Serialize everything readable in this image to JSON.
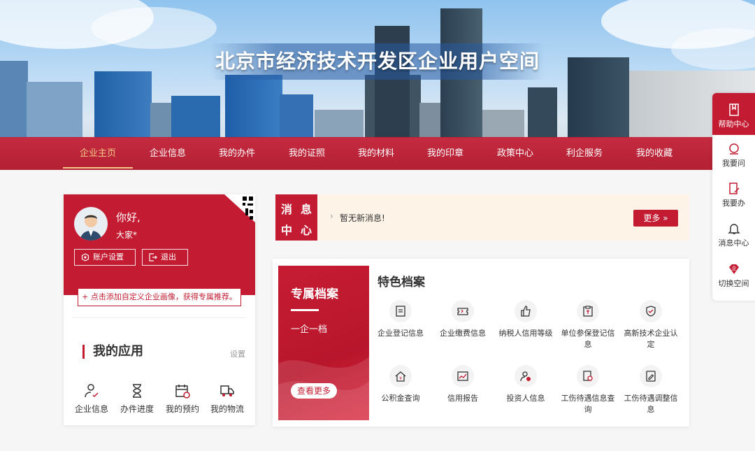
{
  "banner": {
    "title": "北京市经济技术开发区企业用户空间"
  },
  "nav": {
    "items": [
      "企业主页",
      "企业信息",
      "我的办件",
      "我的证照",
      "我的材料",
      "我的印章",
      "政策中心",
      "利企服务",
      "我的收藏"
    ],
    "active_index": 0
  },
  "sidebar": {
    "items": [
      "帮助中心",
      "我要问",
      "我要办",
      "消息中心",
      "切换空间"
    ]
  },
  "profile": {
    "greeting": "你好,",
    "username": "大家*",
    "account_btn": "账户设置",
    "logout_btn": "退出",
    "add_portrait": "+ 点击添加自定义企业画像，获得专属推荐。"
  },
  "my_apps": {
    "title": "我的应用",
    "setting": "设置",
    "items": [
      "企业信息",
      "办件进度",
      "我的预约",
      "我的物流"
    ]
  },
  "message": {
    "badge": [
      "消",
      "息",
      "中",
      "心"
    ],
    "text": "暂无新消息!",
    "more": "更多 »"
  },
  "exclusive": {
    "title": "专属档案",
    "subtitle": "一企一档",
    "button": "查看更多"
  },
  "features": {
    "title": "特色档案",
    "items": [
      "企业登记信息",
      "企业缴费信息",
      "纳税人信用等级",
      "单位参保登记信息",
      "高新技术企业认定",
      "公积金查询",
      "信用报告",
      "投资人信息",
      "工伤待遇信息查询",
      "工伤待遇调整信息"
    ]
  },
  "colors": {
    "brand": "#c31c32",
    "accent": "#f5c98a"
  }
}
